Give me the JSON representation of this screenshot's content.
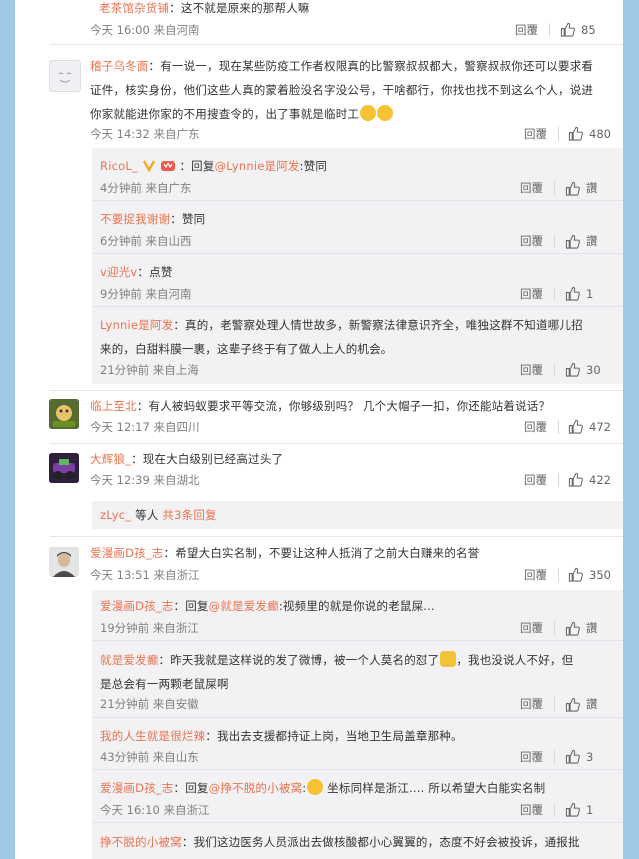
{
  "comments": {
    "c0": {
      "name": "老茶馆杂货铺",
      "text": "：这不就是原来的那帮人嘛",
      "time": "今天 16:00 来自河南",
      "reply": "回覆",
      "likes": "85"
    },
    "c1": {
      "name": "稽子乌冬面",
      "line1": "：有一说一，现在某些防疫工作者权限真的比警察叔叔都大，警察叔叔你还可以要求看",
      "line2": "证件，核实身份，他们这些人真的蒙着脸没名字没公号，干啥都行，你找也找不到这么个人，说进",
      "line3": "你家就能进你家的不用搜查令的，出了事就是临时工",
      "time": "今天 14:32 来自广东",
      "reply": "回覆",
      "likes": "480"
    },
    "r1a": {
      "name": "RicoL_",
      "pre": "：回复",
      "mention": "@Lynnie是阿发",
      "text": ":赞同",
      "time": "4分钟前 来自广东",
      "reply": "回覆",
      "likes": "讚"
    },
    "r1b": {
      "name": "不要捉我谢谢",
      "text": "：赞同",
      "time": "6分钟前 来自山西",
      "reply": "回覆",
      "likes": "讚"
    },
    "r1c": {
      "name": "v迎光v",
      "text": "：点赞",
      "time": "9分钟前 来自河南",
      "reply": "回覆",
      "likes": "1"
    },
    "r1d": {
      "name": "Lynnie是阿发",
      "line1": "：真的，老警察处理人情世故多，新警察法律意识齐全，唯独这群不知道哪儿招",
      "line2": "来的，白甜料膜一裹，这辈子终于有了做人上人的机会。",
      "time": "21分钟前 来自上海",
      "reply": "回覆",
      "likes": "30"
    },
    "c2": {
      "name": "临上至北",
      "text": "：有人被蚂蚁要求平等交流，你够级别吗？ 几个大帽子一扣，你还能站着说话？",
      "time": "今天 12:17 来自四川",
      "reply": "回覆",
      "likes": "472"
    },
    "c3": {
      "name": "大辉狼_",
      "text": "：现在大白级别已经高过头了",
      "time": "今天 12:39 来自湖北",
      "reply": "回覆",
      "likes": "422"
    },
    "more3": {
      "name": "zLyc_",
      "mid": " 等人 ",
      "link": "共3条回复"
    },
    "c4": {
      "name": "爱漫画D孩_志",
      "text": "：希望大白实名制，不要让这种人抵消了之前大白赚来的名誉",
      "time": "今天 13:51 来自浙江",
      "reply": "回覆",
      "likes": "350"
    },
    "r4a": {
      "name": "爱漫画D孩_志",
      "pre": "：回复",
      "mention": "@就是爱发癫",
      "text": ":视频里的就是你说的老鼠屎...",
      "time": "19分钟前 来自浙江",
      "reply": "回覆",
      "likes": "讚"
    },
    "r4b": {
      "name": "就是爱发癫",
      "line1": "：昨天我就是这样说的发了微博，被一个人莫名的怼了",
      "line1b": "，我也没说人不好，但",
      "line2": "是总会有一两颗老鼠屎啊",
      "time": "21分钟前 来自安徽",
      "reply": "回覆",
      "likes": "讚"
    },
    "r4c": {
      "name": "我的人生就是很烂辣",
      "text": "：我出去支援都持证上岗，当地卫生局盖章那种。",
      "time": "43分钟前 来自山东",
      "reply": "回覆",
      "likes": "3"
    },
    "r4d": {
      "name": "爱漫画D孩_志",
      "pre": "：回复",
      "mention": "@挣不脱的小被窝",
      "text": ":",
      "text2": " 坐标同样是浙江.... 所以希望大白能实名制",
      "time": "今天 16:10 来自浙江",
      "reply": "回覆",
      "likes": "1"
    },
    "r4e": {
      "name": "挣不脱的小被窝",
      "text": "：我们这边医务人员派出去做核酸都小心翼翼的，态度不好会被投诉，通报批"
    }
  },
  "colors": {
    "name": "#eb7350",
    "bg": "#9ec8e6",
    "sub_bg": "#f2f2f5"
  }
}
